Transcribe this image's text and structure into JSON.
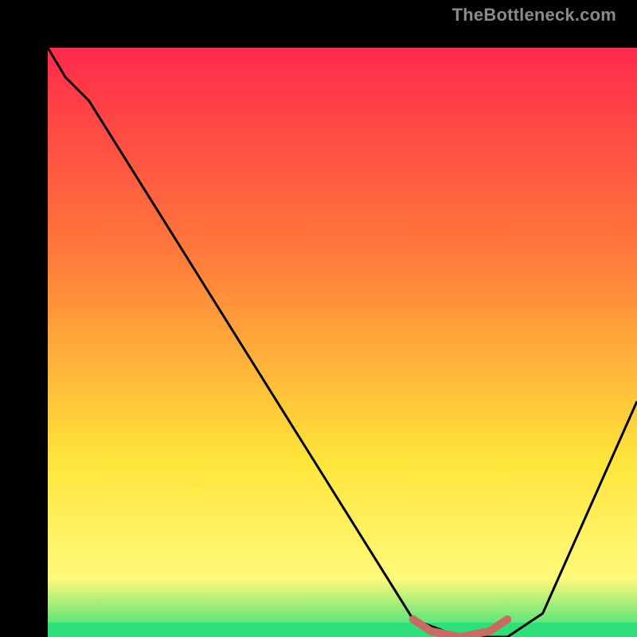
{
  "watermark": "TheBottleneck.com",
  "colors": {
    "gradient_top": "#ff2a4b",
    "gradient_mid1": "#ff7a3a",
    "gradient_mid2": "#ffe53a",
    "gradient_bottom_yellow": "#fff97a",
    "gradient_green": "#2de07a",
    "background": "#000000",
    "curve": "#000000",
    "marker": "#c96a63"
  },
  "chart_data": {
    "type": "line",
    "title": "",
    "xlabel": "",
    "ylabel": "",
    "xlim": [
      0,
      100
    ],
    "ylim": [
      0,
      100
    ],
    "series": [
      {
        "name": "bottleneck-curve",
        "x": [
          0,
          3,
          7,
          62,
          70,
          78,
          84,
          100
        ],
        "y": [
          100,
          95,
          91,
          3,
          0,
          0,
          4,
          40
        ]
      },
      {
        "name": "optimal-range-marker",
        "x": [
          62,
          65,
          70,
          75,
          78
        ],
        "y": [
          3,
          1,
          0,
          1,
          3
        ]
      }
    ],
    "annotations": []
  }
}
